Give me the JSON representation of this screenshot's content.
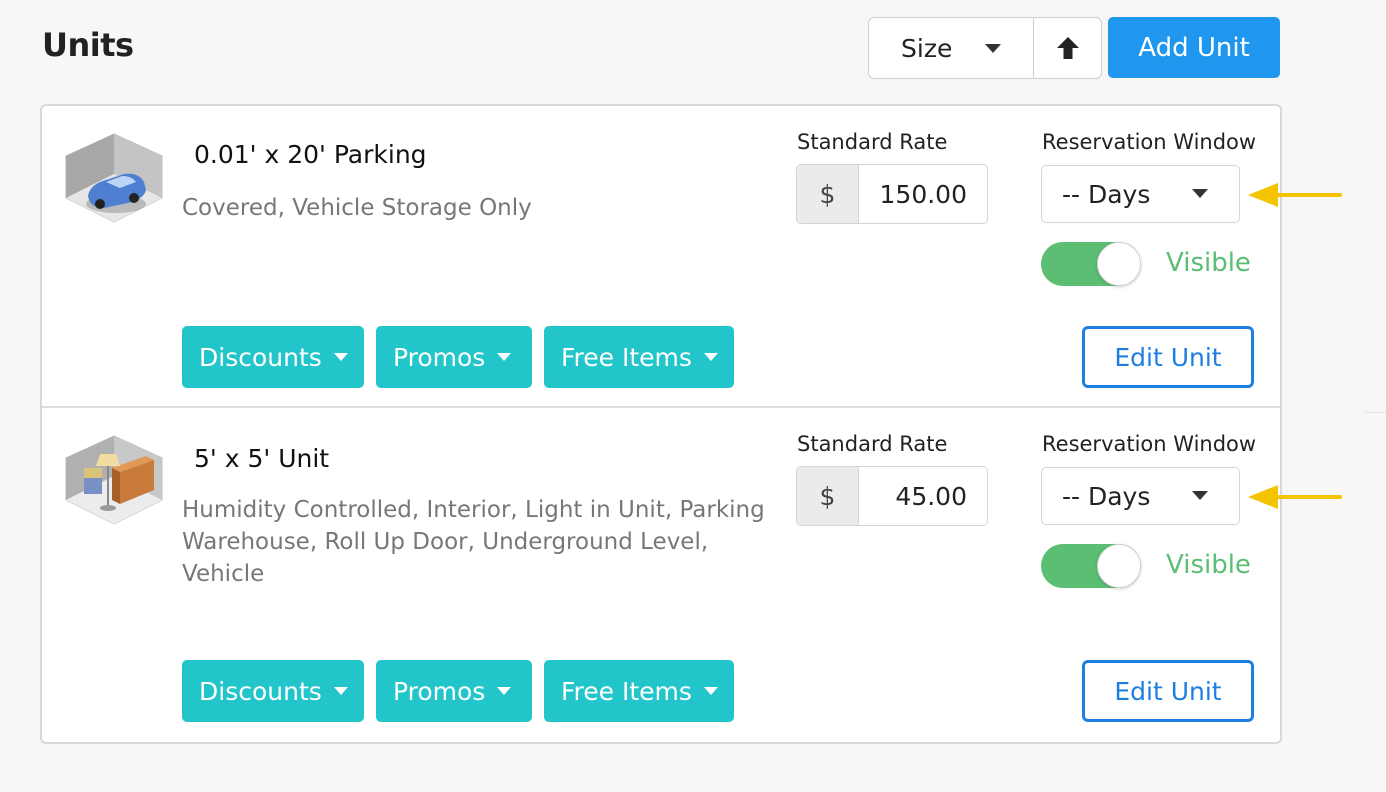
{
  "header": {
    "title": "Units",
    "sort_value": "Size",
    "add_unit_label": "Add Unit"
  },
  "units": [
    {
      "name": "0.01' x 20' Parking",
      "description": "Covered, Vehicle Storage Only",
      "rate_label": "Standard Rate",
      "currency": "$",
      "rate": "150.00",
      "window_label": "Reservation Window",
      "window_value": "-- Days",
      "visible": true,
      "visible_label": "Visible",
      "discounts_label": "Discounts",
      "promos_label": "Promos",
      "free_items_label": "Free Items",
      "edit_label": "Edit Unit",
      "thumb_icon": "parking-car-icon"
    },
    {
      "name": "5' x 5' Unit",
      "description": "Humidity Controlled, Interior, Light in Unit, Parking Warehouse, Roll Up Door, Underground Level, Vehicle",
      "rate_label": "Standard Rate",
      "currency": "$",
      "rate": "45.00",
      "window_label": "Reservation Window",
      "window_value": "-- Days",
      "visible": true,
      "visible_label": "Visible",
      "discounts_label": "Discounts",
      "promos_label": "Promos",
      "free_items_label": "Free Items",
      "edit_label": "Edit Unit",
      "thumb_icon": "storage-room-furniture-icon"
    }
  ],
  "colors": {
    "primary": "#1f97ee",
    "teal": "#22c5c9",
    "toggle_on": "#5cbe73",
    "edit_blue": "#1f7fe0",
    "annotation_arrow": "#f5c400"
  }
}
